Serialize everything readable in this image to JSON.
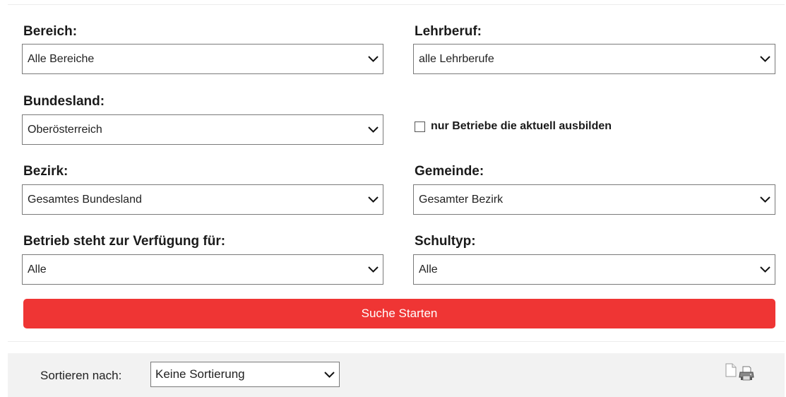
{
  "form": {
    "bereich": {
      "label": "Bereich:",
      "value": "Alle Bereiche"
    },
    "lehrberuf": {
      "label": "Lehrberuf:",
      "value": "alle Lehrberufe"
    },
    "bundesland": {
      "label": "Bundesland:",
      "value": "Oberösterreich"
    },
    "checkbox": {
      "label": "nur Betriebe die aktuell ausbilden",
      "checked": false
    },
    "bezirk": {
      "label": "Bezirk:",
      "value": "Gesamtes Bundesland"
    },
    "gemeinde": {
      "label": "Gemeinde:",
      "value": "Gesamter Bezirk"
    },
    "verfuegung": {
      "label": "Betrieb steht zur Verfügung für:",
      "value": "Alle"
    },
    "schultyp": {
      "label": "Schultyp:",
      "value": "Alle"
    },
    "search_button": "Suche Starten",
    "accent_color": "#ef3534"
  },
  "sort": {
    "label": "Sortieren nach:",
    "value": "Keine Sortierung"
  },
  "icons": {
    "document": "document-icon",
    "print": "printer-icon"
  }
}
